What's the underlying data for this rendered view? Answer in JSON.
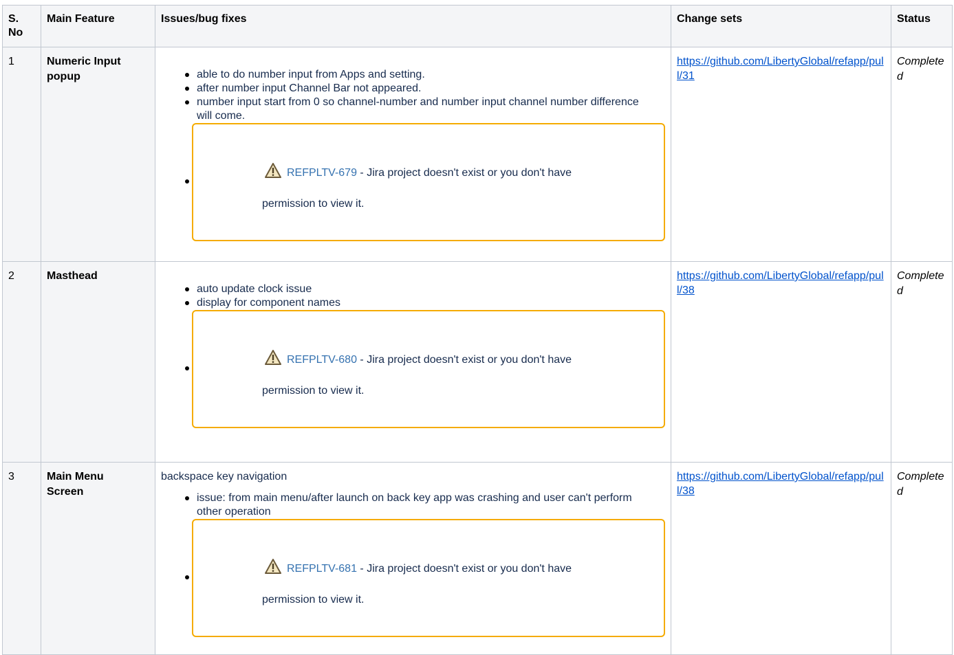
{
  "headers": {
    "sno": "S. No",
    "feature": "Main Feature",
    "issues": "Issues/bug fixes",
    "changes": "Change sets",
    "status": "Status"
  },
  "rows": [
    {
      "num": "1",
      "feature": "Numeric Input popup",
      "intro": "",
      "bullets": [
        "able to do number input from Apps and setting.",
        "after number input Channel Bar not appeared.",
        "number input start from 0 so channel-number and number input channel number difference will come."
      ],
      "jira_key": "REFPLTV-679",
      "jira_msg1": " - Jira project doesn't exist or you don't have",
      "jira_msg2": "permission to view it.",
      "link": "https://github.com/LibertyGlobal/refapp/pull/31",
      "status": "Completed"
    },
    {
      "num": "2",
      "feature": "Masthead",
      "intro": "",
      "bullets": [
        "auto update clock issue",
        "display for component names"
      ],
      "jira_key": "REFPLTV-680",
      "jira_msg1": " - Jira project doesn't exist or you don't have",
      "jira_msg2": "permission to view it.",
      "link": "https://github.com/LibertyGlobal/refapp/pull/38",
      "status": "Completed"
    },
    {
      "num": "3",
      "feature": "Main Menu Screen",
      "intro": "backspace key navigation",
      "bullets": [
        "issue: from main menu/after launch on back key app was crashing and user can't perform other operation"
      ],
      "jira_key": "REFPLTV-681",
      "jira_msg1": " - Jira project doesn't exist or you don't have",
      "jira_msg2": "permission to view it.",
      "link": "https://github.com/LibertyGlobal/refapp/pull/38",
      "status": "Completed"
    }
  ],
  "colors": {
    "box_border": "#f5ab00",
    "jira_link": "#3572b0",
    "link": "#0052cc",
    "header_bg": "#f4f5f7"
  },
  "icons": {
    "warning": "warning-icon"
  }
}
